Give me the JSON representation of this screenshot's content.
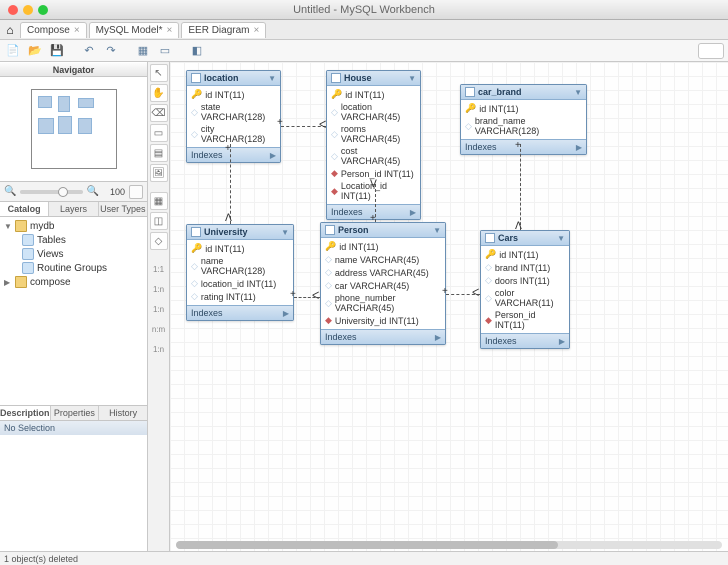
{
  "window": {
    "title": "Untitled - MySQL Workbench"
  },
  "tabs": [
    {
      "label": "Compose",
      "close": "×"
    },
    {
      "label": "MySQL Model*",
      "close": "×"
    },
    {
      "label": "EER Diagram",
      "close": "×",
      "active": true
    }
  ],
  "sidebar": {
    "navigator_label": "Navigator",
    "zoom_value": "100",
    "catalog_tabs": [
      "Catalog",
      "Layers",
      "User Types"
    ],
    "tree": {
      "db1": "mydb",
      "db1_children": [
        "Tables",
        "Views",
        "Routine Groups"
      ],
      "db2": "compose"
    },
    "desc_tabs": [
      "Description",
      "Properties",
      "History"
    ],
    "no_selection": "No Selection"
  },
  "palette": {
    "rel11": "1:1",
    "rel1n_a": "1:n",
    "rel1n_b": "1:n",
    "relnm": "n:m",
    "rel1n_c": "1:n"
  },
  "tables": {
    "location": {
      "name": "location",
      "indexes": "Indexes",
      "cols": [
        {
          "k": "pk",
          "t": "id INT(11)"
        },
        {
          "k": "",
          "t": "state VARCHAR(128)"
        },
        {
          "k": "",
          "t": "city VARCHAR(128)"
        }
      ]
    },
    "house": {
      "name": "House",
      "indexes": "Indexes",
      "cols": [
        {
          "k": "pk",
          "t": "id INT(11)"
        },
        {
          "k": "",
          "t": "location VARCHAR(45)"
        },
        {
          "k": "",
          "t": "rooms VARCHAR(45)"
        },
        {
          "k": "",
          "t": "cost VARCHAR(45)"
        },
        {
          "k": "fk",
          "t": "Person_id INT(11)"
        },
        {
          "k": "fk",
          "t": "Location_id INT(11)"
        }
      ]
    },
    "car_brand": {
      "name": "car_brand",
      "indexes": "Indexes",
      "cols": [
        {
          "k": "pk",
          "t": "id INT(11)"
        },
        {
          "k": "",
          "t": "brand_name VARCHAR(128)"
        }
      ]
    },
    "university": {
      "name": "University",
      "indexes": "Indexes",
      "cols": [
        {
          "k": "pk",
          "t": "id INT(11)"
        },
        {
          "k": "",
          "t": "name VARCHAR(128)"
        },
        {
          "k": "",
          "t": "location_id INT(11)"
        },
        {
          "k": "",
          "t": "rating INT(11)"
        }
      ]
    },
    "person": {
      "name": "Person",
      "indexes": "Indexes",
      "cols": [
        {
          "k": "pk",
          "t": "id INT(11)"
        },
        {
          "k": "",
          "t": "name VARCHAR(45)"
        },
        {
          "k": "",
          "t": "address VARCHAR(45)"
        },
        {
          "k": "",
          "t": "car VARCHAR(45)"
        },
        {
          "k": "",
          "t": "phone_number VARCHAR(45)"
        },
        {
          "k": "fk",
          "t": "University_id INT(11)"
        }
      ]
    },
    "cars": {
      "name": "Cars",
      "indexes": "Indexes",
      "cols": [
        {
          "k": "pk",
          "t": "id INT(11)"
        },
        {
          "k": "",
          "t": "brand INT(11)"
        },
        {
          "k": "",
          "t": "doors INT(11)"
        },
        {
          "k": "",
          "t": "color VARCHAR(11)"
        },
        {
          "k": "fk",
          "t": "Person_id INT(11)"
        }
      ]
    }
  },
  "status": {
    "text": "1 object(s) deleted"
  }
}
